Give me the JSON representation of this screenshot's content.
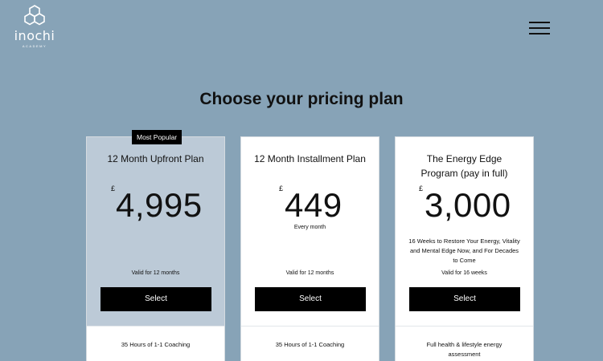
{
  "header": {
    "logo_name": "inochi",
    "logo_sub": "ACADEMY"
  },
  "page": {
    "title": "Choose your pricing plan"
  },
  "plans": [
    {
      "badge": "Most Popular",
      "name": "12 Month Upfront Plan",
      "currency": "£",
      "price": "4,995",
      "price_sub": "",
      "description": "",
      "valid": "Valid for 12 months",
      "button": "Select",
      "features": [
        "35 Hours of 1-1 Coaching"
      ]
    },
    {
      "badge": "",
      "name": "12 Month Installment Plan",
      "currency": "£",
      "price": "449",
      "price_sub": "Every month",
      "description": "",
      "valid": "Valid for 12 months",
      "button": "Select",
      "features": [
        "35 Hours of 1-1 Coaching"
      ]
    },
    {
      "badge": "",
      "name": "The Energy Edge Program (pay in full)",
      "currency": "£",
      "price": "3,000",
      "price_sub": "",
      "description": "16 Weeks to Restore Your Energy, Vitality and Mental Edge Now, and For Decades to Come",
      "valid": "Valid for 16 weeks",
      "button": "Select",
      "features": [
        "Full health & lifestyle energy assessment"
      ]
    }
  ],
  "colors": {
    "background": "#87a3b7",
    "popular_card": "#bccad7",
    "button": "#000000"
  },
  "icons": {
    "logo": "hexagon-cluster-icon",
    "menu": "hamburger-menu-icon"
  }
}
